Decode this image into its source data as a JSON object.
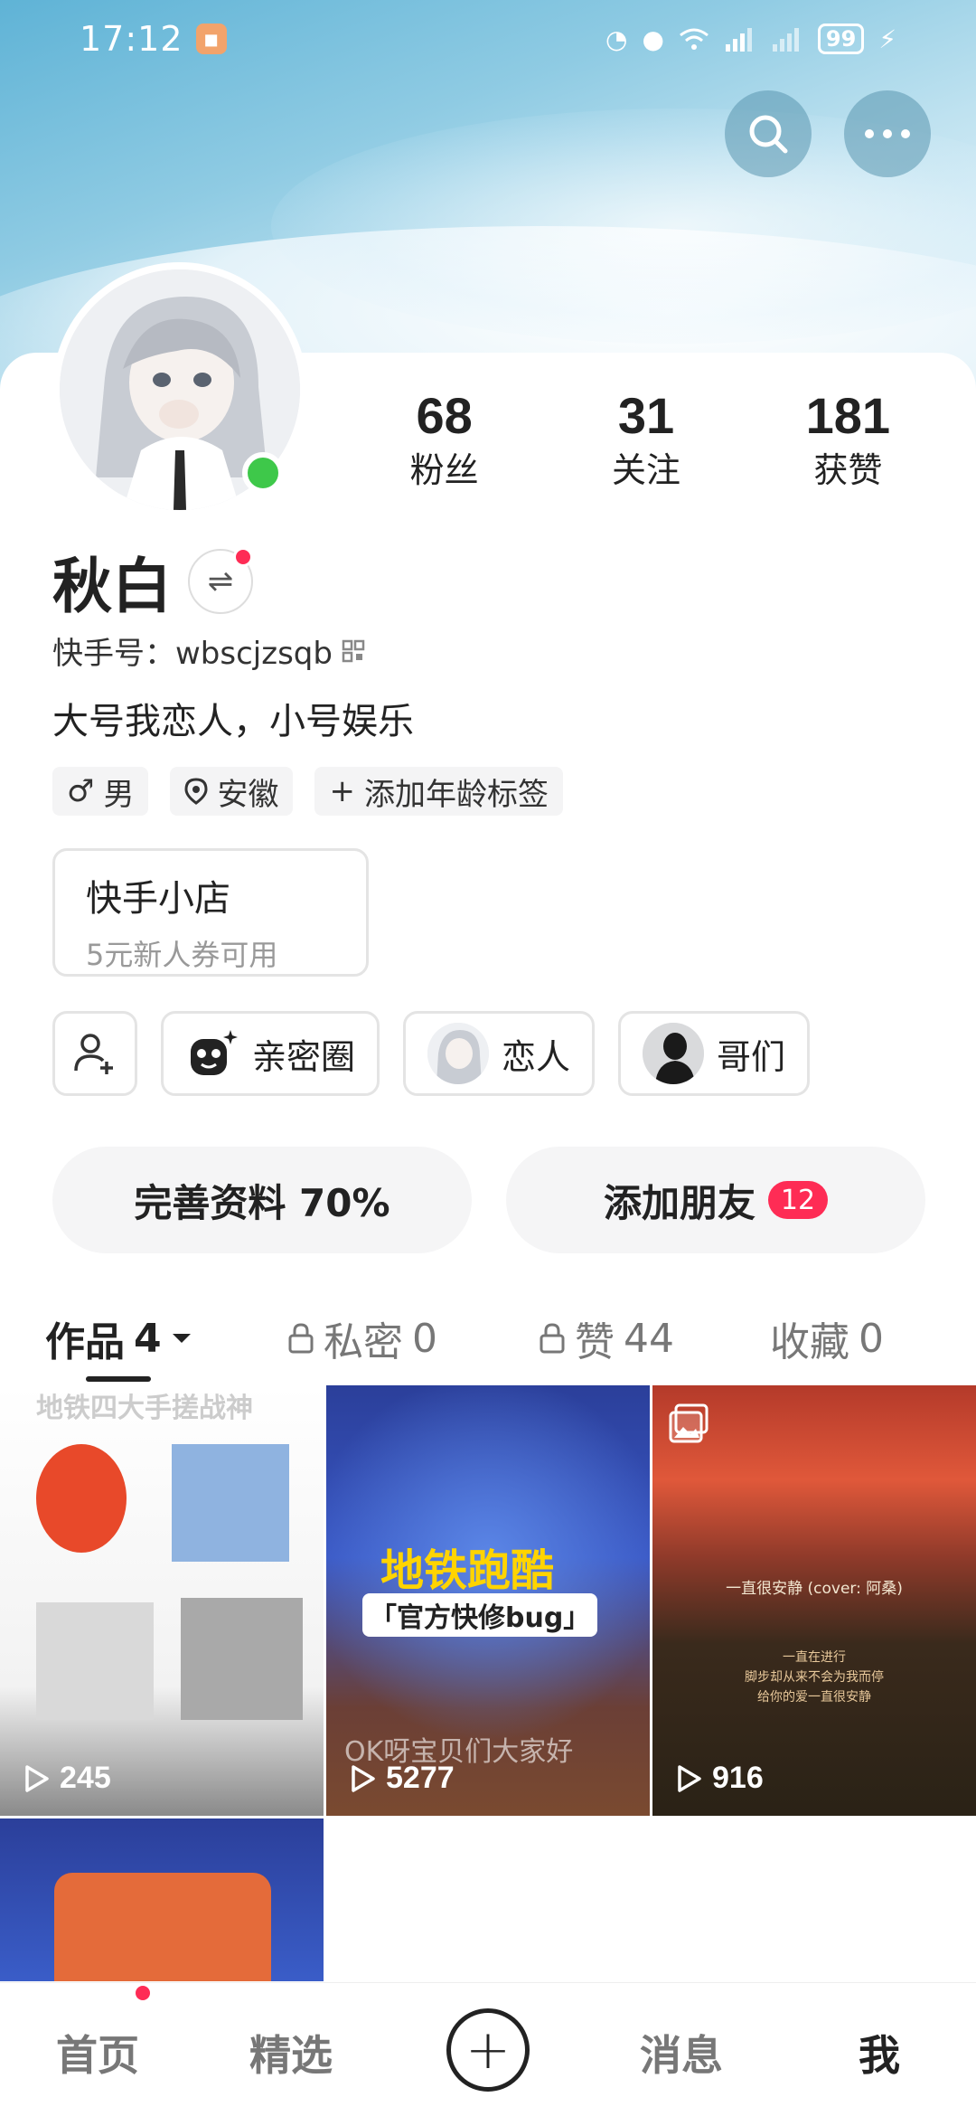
{
  "status_bar": {
    "time": "17:12",
    "battery": "99"
  },
  "profile": {
    "name": "秋白",
    "kwai_id": "快手号：wbscjzsqb",
    "bio": "大号我恋人，小号娱乐",
    "stats": [
      {
        "value": "68",
        "label": "粉丝"
      },
      {
        "value": "31",
        "label": "关注"
      },
      {
        "value": "181",
        "label": "获赞"
      }
    ],
    "tags": [
      {
        "icon": "male-icon",
        "text": "男"
      },
      {
        "icon": "location-pin-icon",
        "text": "安徽"
      },
      {
        "icon": "plus-icon",
        "text": "添加年龄标签"
      }
    ]
  },
  "shop": {
    "title": "快手小店",
    "subtitle": "5元新人券可用"
  },
  "circles": [
    {
      "label": "亲密圈",
      "icon": "intimate-circle-icon"
    },
    {
      "label": "恋人",
      "icon": "avatar"
    },
    {
      "label": "哥们",
      "icon": "avatar"
    }
  ],
  "actions": {
    "complete_profile": "完善资料 70%",
    "add_friends": "添加朋友",
    "add_friends_badge": "12"
  },
  "tabs": [
    {
      "label": "作品",
      "count": "4",
      "active": true
    },
    {
      "label": "私密",
      "count": "0",
      "locked": true
    },
    {
      "label": "赞",
      "count": "44",
      "locked": true
    },
    {
      "label": "收藏",
      "count": "0"
    }
  ],
  "videos": [
    {
      "plays": "245",
      "caption": "地铁四大手搓战神"
    },
    {
      "plays": "5277",
      "title": "地铁跑酷",
      "subtitle": "「官方快修bug」",
      "overlay": "OK呀宝贝们大家好"
    },
    {
      "plays": "916",
      "song": "一直很安静 (cover: 阿桑)",
      "lyric1": "一直在进行",
      "lyric2": "脚步却从来不会为我而停",
      "lyric3": "给你的爱一直很安静"
    },
    {
      "plays": ""
    }
  ],
  "bottom_nav": [
    {
      "label": "首页"
    },
    {
      "label": "精选"
    },
    {
      "label": "消息"
    },
    {
      "label": "我"
    }
  ],
  "colors": {
    "accent": "#fe2c55",
    "online": "#3ec84a"
  }
}
